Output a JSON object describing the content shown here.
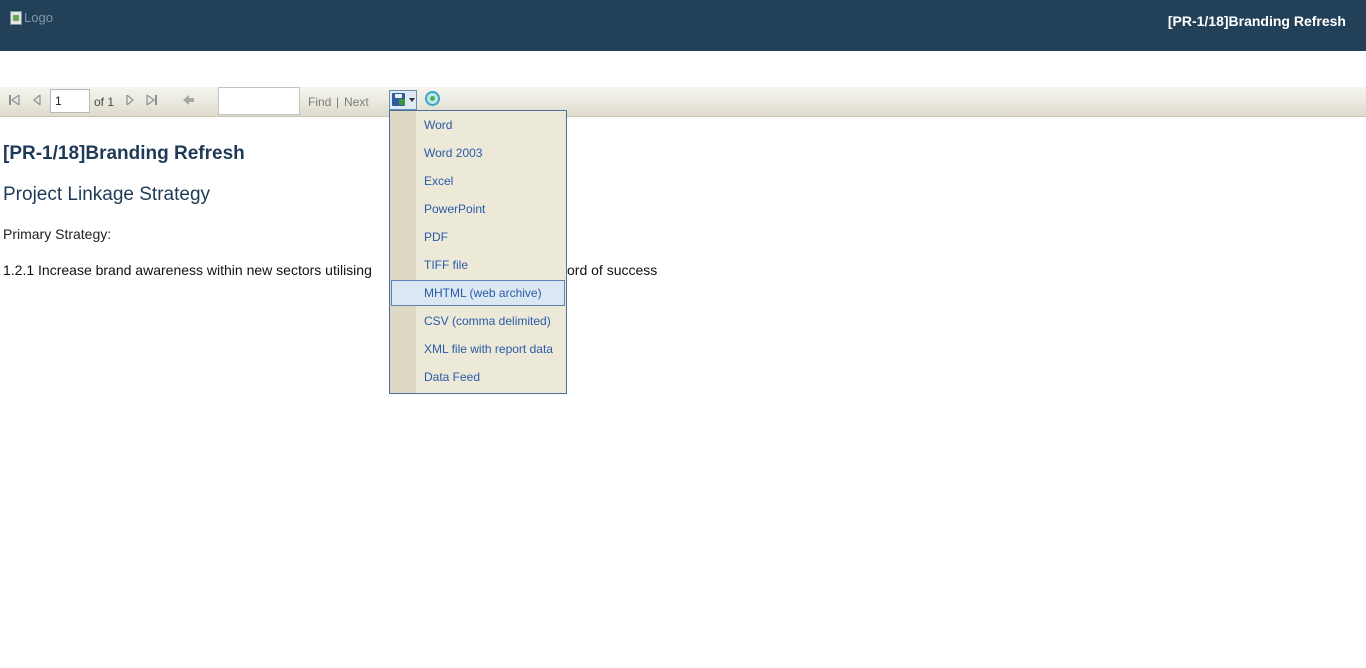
{
  "header": {
    "logo_alt": "Logo",
    "title": "[PR-1/18]Branding Refresh"
  },
  "toolbar": {
    "current_page": "1",
    "of_pages": "of 1",
    "find_label": "Find",
    "separator": "|",
    "next_label": "Next",
    "find_value": ""
  },
  "report": {
    "title": "[PR-1/18]Branding Refresh",
    "section": "Project Linkage Strategy",
    "primary_label": "Primary Strategy:",
    "strategy_text": "1.2.1 Increase brand awareness within new sectors utilising"
  },
  "export_menu": {
    "items": [
      {
        "label": "Word"
      },
      {
        "label": "Word 2003"
      },
      {
        "label": "Excel"
      },
      {
        "label": "PowerPoint"
      },
      {
        "label": "PDF"
      },
      {
        "label": "TIFF file"
      },
      {
        "label": "MHTML (web archive)"
      },
      {
        "label": "CSV (comma delimited)"
      },
      {
        "label": "XML file with report data"
      },
      {
        "label": "Data Feed"
      }
    ],
    "highlighted": "MHTML (web archive)"
  },
  "behind_menu_text": "ord of success",
  "colors": {
    "header_bg": "#234059",
    "title_color": "#1f3a57",
    "menu_text": "#2a5aa8"
  }
}
